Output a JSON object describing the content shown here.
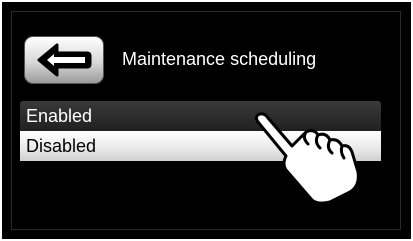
{
  "header": {
    "title": "Maintenance scheduling",
    "back_icon": "left-arrow-icon"
  },
  "options": [
    {
      "label": "Enabled",
      "selected": false
    },
    {
      "label": "Disabled",
      "selected": true
    }
  ],
  "overlay": {
    "icon": "pointing-hand-icon"
  },
  "colors": {
    "background": "#000000",
    "selected_row": "#ffffff",
    "row": "#2a2a2a",
    "text": "#ffffff"
  }
}
